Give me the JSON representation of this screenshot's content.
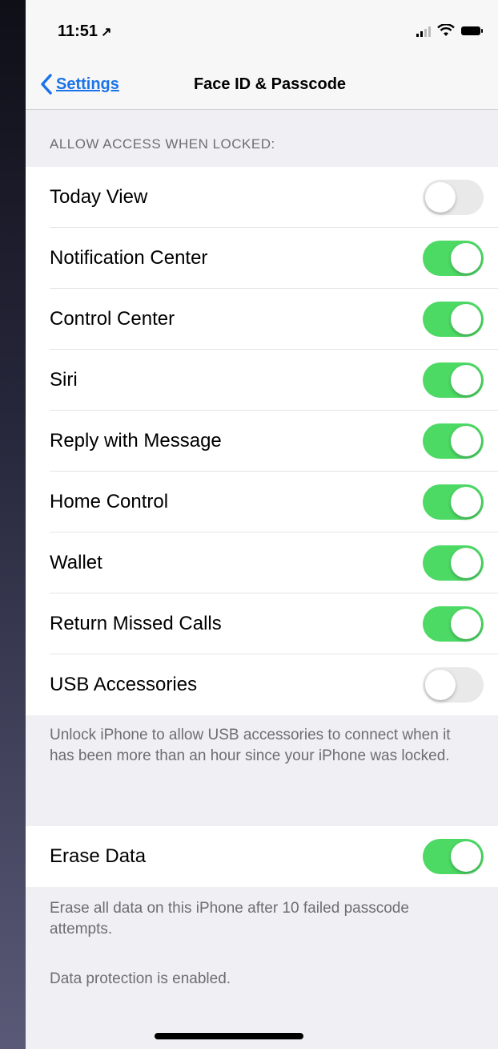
{
  "status_bar": {
    "time": "11:51",
    "location_glyph": "↗"
  },
  "nav": {
    "back_label": "Settings",
    "title": "Face ID & Passcode"
  },
  "section": {
    "header": "ALLOW ACCESS WHEN LOCKED:"
  },
  "toggles": [
    {
      "label": "Today View",
      "on": false
    },
    {
      "label": "Notification Center",
      "on": true
    },
    {
      "label": "Control Center",
      "on": true
    },
    {
      "label": "Siri",
      "on": true
    },
    {
      "label": "Reply with Message",
      "on": true
    },
    {
      "label": "Home Control",
      "on": true
    },
    {
      "label": "Wallet",
      "on": true
    },
    {
      "label": "Return Missed Calls",
      "on": true
    },
    {
      "label": "USB Accessories",
      "on": false
    }
  ],
  "usb_footer": "Unlock iPhone to allow USB accessories to connect when it has been more than an hour since your iPhone was locked.",
  "erase": {
    "label": "Erase Data",
    "on": true
  },
  "erase_footer": "Erase all data on this iPhone after 10 failed passcode attempts.",
  "protection_footer": "Data protection is enabled.",
  "colors": {
    "toggle_on": "#4cd964",
    "toggle_off": "#e9e9ea",
    "link": "#1a73e8"
  }
}
